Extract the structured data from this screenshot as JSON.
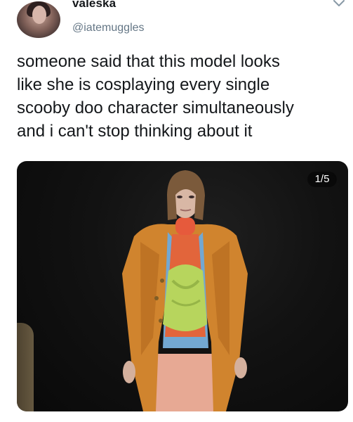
{
  "post": {
    "display_name": "valeska",
    "handle": "@iatemuggles",
    "text": "someone said that this model looks\nlike she is cosplaying every single\nscooby doo character simultaneously\nand i can't stop thinking about it",
    "media_counter": "1/5"
  },
  "icons": {
    "avatar": "profile-photo",
    "menu": "chevron-down-icon"
  }
}
